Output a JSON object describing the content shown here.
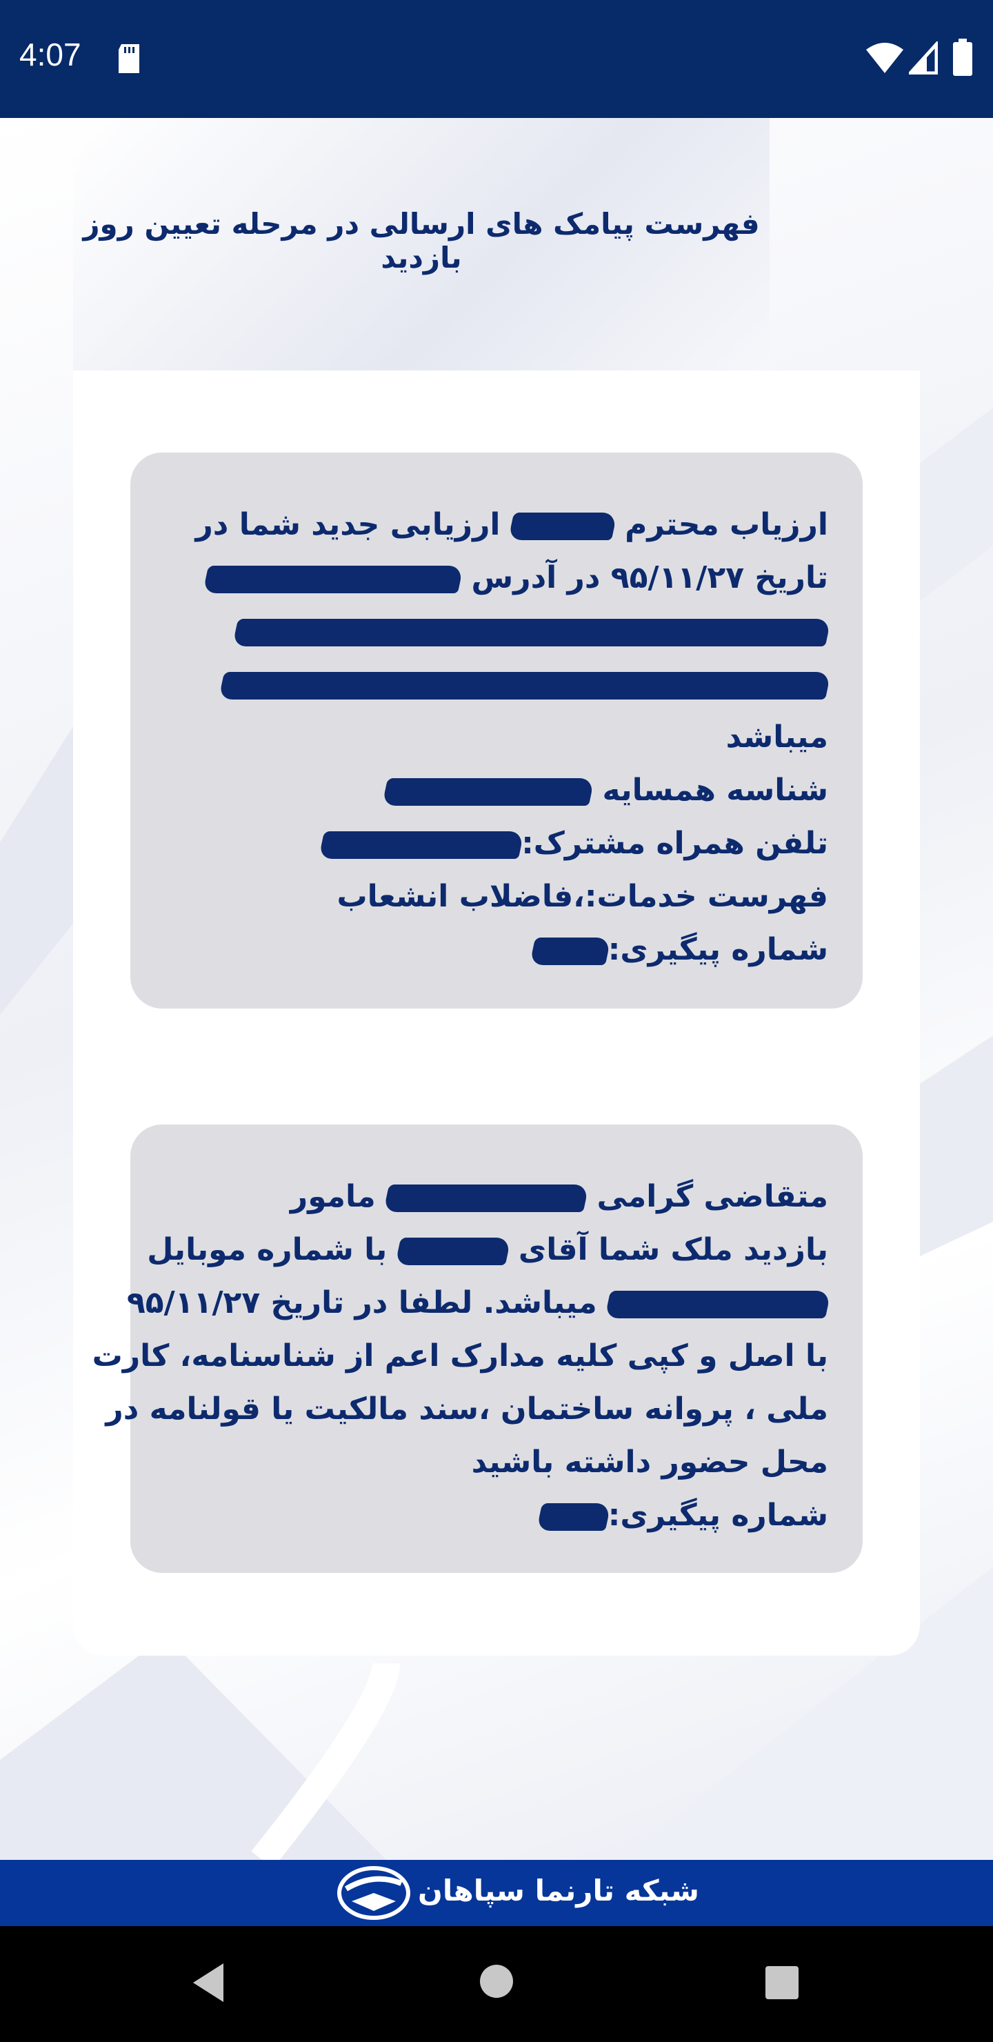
{
  "status_bar": {
    "time": "4:07",
    "icons": [
      "sd-card-icon",
      "wifi-icon",
      "signal-icon",
      "battery-icon"
    ]
  },
  "page": {
    "title": "فهرست پیامک های ارسالی در مرحله تعیین روز بازدید"
  },
  "messages": [
    {
      "lines": [
        {
          "before": "ارزیاب محترم ",
          "after": " ارزیابی جدید شما در"
        },
        {
          "before": "تاریخ ۹۵/۱۱/۲۷ در آدرس ",
          "after": ""
        },
        {
          "before": "",
          "after": ""
        },
        {
          "before": "",
          "after": ""
        },
        {
          "before": "میباشد",
          "after": ""
        },
        {
          "before": "شناسه همسایه ",
          "after": ""
        },
        {
          "before": "تلفن همراه مشترک:",
          "after": ""
        },
        {
          "before": "فهرست خدمات:،فاضلاب انشعاب",
          "after": ""
        },
        {
          "before": "شماره پیگیری:",
          "after": ""
        }
      ]
    },
    {
      "lines": [
        {
          "before": "متقاضی گرامی ",
          "after": " مامور"
        },
        {
          "before": "بازدید ملک شما آقای ",
          "after": " با شماره موبایل"
        },
        {
          "before": "",
          "after": " میباشد. لطفا در تاریخ ۹۵/۱۱/۲۷"
        },
        {
          "before": "با اصل و کپی کلیه مدارک اعم از شناسنامه، کارت",
          "after": ""
        },
        {
          "before": "ملی ، پروانه ساختمان ،سند مالکیت یا قولنامه  در",
          "after": ""
        },
        {
          "before": "محل حضور داشته باشید",
          "after": ""
        },
        {
          "before": "شماره پیگیری:",
          "after": ""
        }
      ]
    }
  ],
  "footer": {
    "brand": "شبکه تارنما سپاهان"
  },
  "colors": {
    "status_bar": "#072a68",
    "text_primary": "#0d2a6e",
    "card_bg": "#dedee2",
    "footer_bg": "#06369a"
  }
}
